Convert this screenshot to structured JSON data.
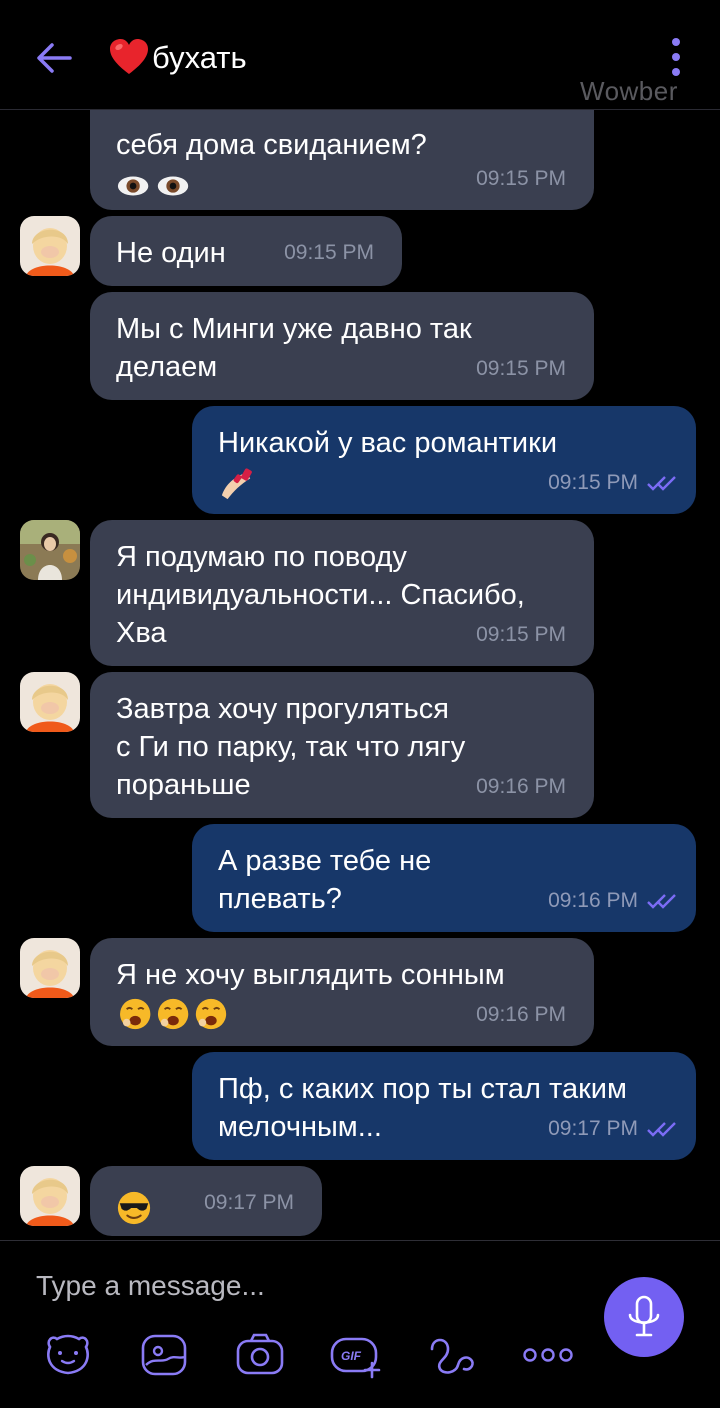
{
  "header": {
    "title": "бухать",
    "watermark": "Wowber"
  },
  "messages": [
    {
      "direction": "in",
      "text": "себя дома свиданием?",
      "emoji": "👀👀",
      "time": "09:15 PM"
    },
    {
      "direction": "in",
      "text": "Не один",
      "time": "09:15 PM"
    },
    {
      "direction": "in",
      "text": "Мы с Минги уже давно так\nделаем",
      "time": "09:15 PM"
    },
    {
      "direction": "out",
      "text": "Никакой у вас романтики",
      "emoji": "💅",
      "time": "09:15 PM",
      "status": "read"
    },
    {
      "direction": "in",
      "text": "Я подумаю по поводу\nиндивидуальности... Спасибо,\nХва",
      "time": "09:15 PM"
    },
    {
      "direction": "in",
      "text": "Завтра хочу прогуляться\nс Ги по парку, так что лягу\nпораньше",
      "time": "09:16 PM"
    },
    {
      "direction": "out",
      "text": "А разве тебе не\nплевать?",
      "time": "09:16 PM",
      "status": "read"
    },
    {
      "direction": "in",
      "text": "Я не хочу выглядить сонным",
      "emoji": "🥱🥱🥱",
      "time": "09:16 PM"
    },
    {
      "direction": "out",
      "text": "Пф, с каких пор ты стал таким\nмелочным...",
      "time": "09:17 PM",
      "status": "read"
    },
    {
      "direction": "in",
      "emoji": "😎",
      "time": "09:17 PM"
    }
  ],
  "composer": {
    "placeholder": "Type a message...",
    "tools": [
      "sticker-icon",
      "image-icon",
      "camera-icon",
      "gif-icon",
      "doodle-icon",
      "more-icon"
    ],
    "gif_label": "GIF"
  },
  "colors": {
    "incoming_bubble": "#3a3f50",
    "outgoing_bubble": "#173769",
    "accent": "#7360f2"
  }
}
